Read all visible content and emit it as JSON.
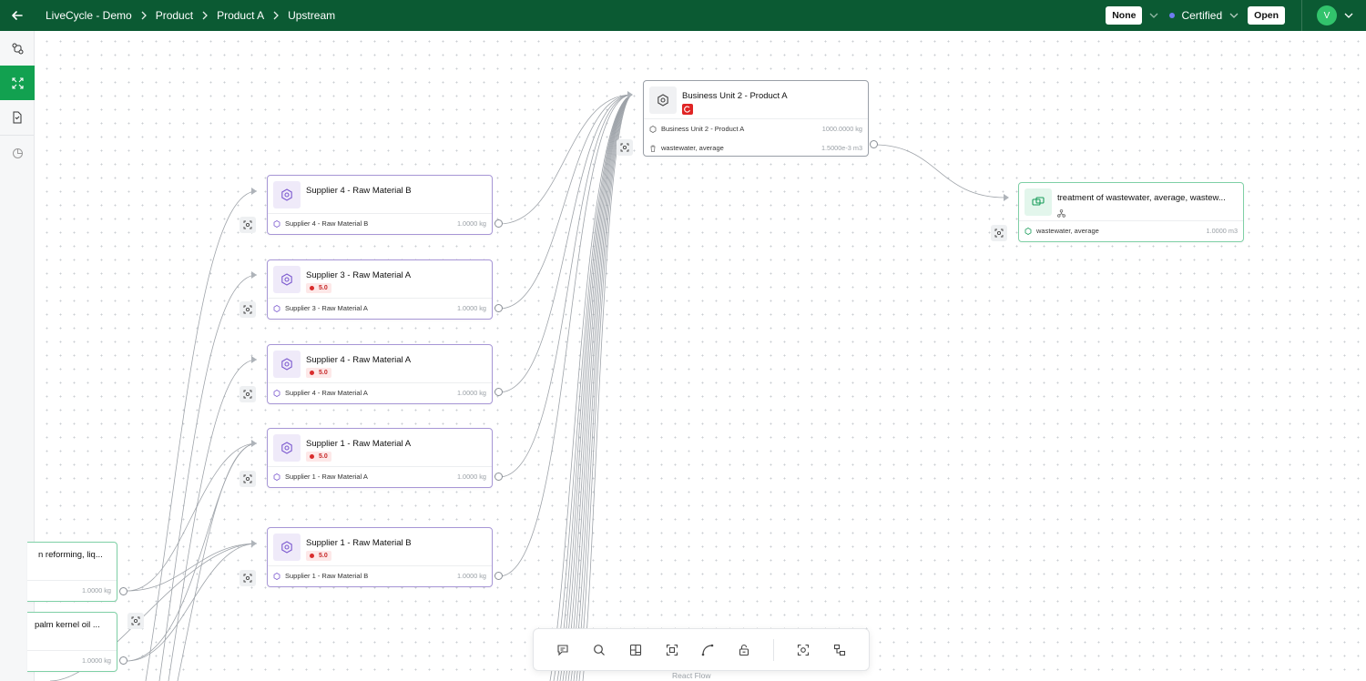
{
  "header": {
    "back_icon": "arrow-left-icon",
    "breadcrumbs": [
      "LiveCycle - Demo",
      "Product",
      "Product A",
      "Upstream"
    ],
    "filter_value": "None",
    "status_label": "Certified",
    "open_label": "Open",
    "avatar_initial": "V"
  },
  "sidebar": {
    "items": [
      {
        "icon": "flow-icon",
        "active": false
      },
      {
        "icon": "expand-icon",
        "active": true
      },
      {
        "icon": "document-icon",
        "active": false
      },
      {
        "icon": "pie-chart-icon",
        "active": false
      }
    ]
  },
  "nodes": {
    "bu": {
      "title": "Business Unit 2 - Product A",
      "rows": [
        {
          "label": "Business Unit 2 - Product A",
          "value": "1000.0000 kg"
        },
        {
          "label": "wastewater, average",
          "value": "1.5000e-3 m3"
        }
      ]
    },
    "treatment": {
      "title": "treatment of wastewater, average, wastew...",
      "rows": [
        {
          "label": "wastewater, average",
          "value": "1.0000 m3"
        }
      ]
    },
    "s4b": {
      "title": "Supplier 4 - Raw Material B",
      "row_label": "Supplier 4 - Raw Material B",
      "row_value": "1.0000 kg"
    },
    "s3a": {
      "title": "Supplier 3 - Raw Material A",
      "score": "5.0",
      "row_label": "Supplier 3 - Raw Material A",
      "row_value": "1.0000 kg"
    },
    "s4a": {
      "title": "Supplier 4 - Raw Material A",
      "score": "5.0",
      "row_label": "Supplier 4 - Raw Material A",
      "row_value": "1.0000 kg"
    },
    "s1a": {
      "title": "Supplier 1 - Raw Material A",
      "score": "5.0",
      "row_label": "Supplier 1 - Raw Material A",
      "row_value": "1.0000 kg"
    },
    "s1b": {
      "title": "Supplier 1 - Raw Material B",
      "score": "5.0",
      "row_label": "Supplier 1 - Raw Material B",
      "row_value": "1.0000 kg"
    },
    "left1": {
      "title": "n reforming, liq...",
      "row_value": "1.0000 kg"
    },
    "left2": {
      "title": "palm kernel oil ...",
      "row_value": "1.0000 kg"
    }
  },
  "toolbar": {
    "icons": [
      "comment-icon",
      "search-icon",
      "layout-icon",
      "fit-view-icon",
      "edge-style-icon",
      "lock-icon",
      "focus-icon",
      "minimap-icon"
    ]
  },
  "attribution": "React Flow"
}
